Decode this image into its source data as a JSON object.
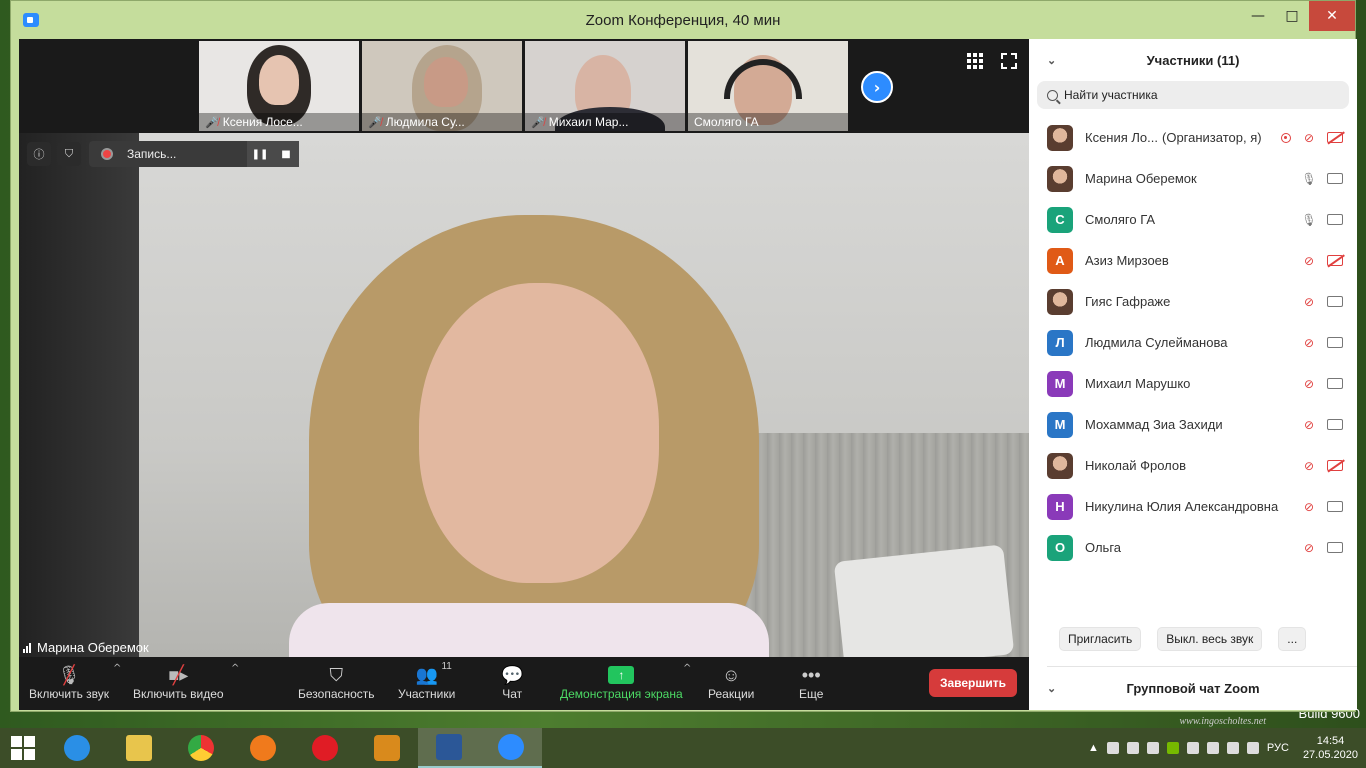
{
  "window": {
    "title": "Zoom Конференция, 40 мин",
    "minimize": "—",
    "maximize": "□",
    "close": "✕"
  },
  "thumbnails": [
    {
      "name": "Ксения Лосе..."
    },
    {
      "name": "Людмила Су..."
    },
    {
      "name": "Михаил Мар..."
    },
    {
      "name": "Смоляго ГА"
    }
  ],
  "recording": {
    "label": "Запись..."
  },
  "main_video": {
    "speaker": "Марина Оберемок"
  },
  "toolbar": {
    "unmute": "Включить звук",
    "start_video": "Включить видео",
    "security": "Безопасность",
    "participants": "Участники",
    "participants_count": "11",
    "chat": "Чат",
    "share_screen": "Демонстрация экрана",
    "reactions": "Реакции",
    "more": "Еще",
    "end": "Завершить"
  },
  "panel": {
    "title": "Участники (11)",
    "search_placeholder": "Найти участника",
    "participants": [
      {
        "name": "Ксения Ло...",
        "role": "(Организатор, я)",
        "avatar": "",
        "avatar_color": "photo",
        "mic": "off",
        "cam": "off",
        "recording": true
      },
      {
        "name": "Марина Оберемок",
        "avatar": "",
        "avatar_color": "photo",
        "mic": "on",
        "cam": "on"
      },
      {
        "name": "Смоляго ГА",
        "avatar": "С",
        "avatar_color": "#1aa37a",
        "mic": "on",
        "cam": "on"
      },
      {
        "name": "Азиз Мирзоев",
        "avatar": "А",
        "avatar_color": "#e05a16",
        "mic": "off",
        "cam": "off"
      },
      {
        "name": "Гияс Гафраже",
        "avatar": "",
        "avatar_color": "photo",
        "mic": "off",
        "cam": "on"
      },
      {
        "name": "Людмила Сулейманова",
        "avatar": "Л",
        "avatar_color": "#2a76c6",
        "mic": "off",
        "cam": "on"
      },
      {
        "name": "Михаил Марушко",
        "avatar": "М",
        "avatar_color": "#8a3ab9",
        "mic": "off",
        "cam": "on"
      },
      {
        "name": "Мохаммад Зиа Захиди",
        "avatar": "М",
        "avatar_color": "#2a76c6",
        "mic": "off",
        "cam": "on"
      },
      {
        "name": "Николай Фролов",
        "avatar": "",
        "avatar_color": "photo",
        "mic": "off",
        "cam": "off"
      },
      {
        "name": "Никулина Юлия Александровна",
        "avatar": "Н",
        "avatar_color": "#8a3ab9",
        "mic": "off",
        "cam": "on"
      },
      {
        "name": "Ольга",
        "avatar": "О",
        "avatar_color": "#1aa37a",
        "mic": "off",
        "cam": "on"
      }
    ],
    "invite": "Пригласить",
    "mute_all": "Выкл. весь звук",
    "more": "...",
    "chat_title": "Групповой чат Zoom"
  },
  "desktop": {
    "build": "Build 9600",
    "watermark": "www.ingoscholtes.net"
  },
  "taskbar": {
    "lang": "РУС",
    "time": "14:54",
    "date": "27.05.2020"
  }
}
